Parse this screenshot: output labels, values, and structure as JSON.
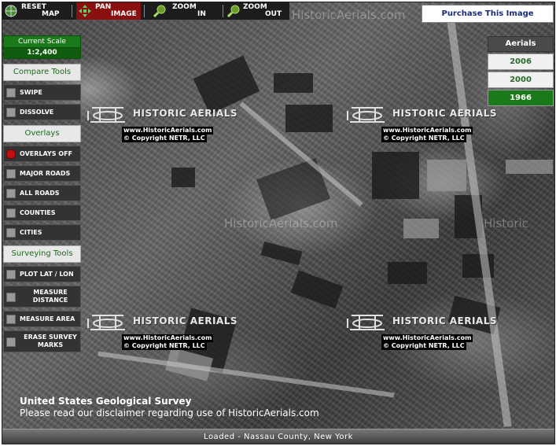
{
  "toolbar": {
    "reset": {
      "l1": "RESET",
      "l2": "MAP",
      "icon": "globe-icon"
    },
    "pan": {
      "l1": "PAN",
      "l2": "IMAGE",
      "icon": "pan-arrows-icon"
    },
    "zoom_in": {
      "l1": "ZOOM",
      "l2": "IN",
      "icon": "magnifier-plus-icon"
    },
    "zoom_out": {
      "l1": "ZOOM",
      "l2": "OUT",
      "icon": "magnifier-minus-icon"
    }
  },
  "purchase_label": "Purchase This Image",
  "scale": {
    "title": "Current Scale",
    "value": "1:2,400"
  },
  "compare": {
    "title": "Compare Tools",
    "items": [
      "SWIPE",
      "DISSOLVE"
    ]
  },
  "overlays": {
    "title": "Overlays",
    "items": [
      "OVERLAYS OFF",
      "MAJOR ROADS",
      "ALL ROADS",
      "COUNTIES",
      "CITIES"
    ]
  },
  "surveying": {
    "title": "Surveying Tools",
    "items": [
      "PLOT LAT / LON",
      "MEASURE DISTANCE",
      "MEASURE AREA",
      "ERASE SURVEY MARKS"
    ]
  },
  "aerials": {
    "title": "Aerials",
    "years": [
      "2006",
      "2000",
      "1966"
    ],
    "selected": "1966"
  },
  "watermark": {
    "title": "HISTORIC AERIALS",
    "url": "www.HistoricAerials.com",
    "copyright": "© Copyright NETR, LLC",
    "faint": "HistoricAerials.com",
    "faint_short": "Historic"
  },
  "footer": {
    "agency": "United States Geological Survey",
    "disclaimer": "Please read our disclaimer regarding use of HistoricAerials.com",
    "status": "Loaded - Nassau County, New York"
  },
  "colors": {
    "accent_green": "#1a7a1a",
    "pan_active": "#8a1010",
    "link_blue": "#1a2a7a"
  }
}
